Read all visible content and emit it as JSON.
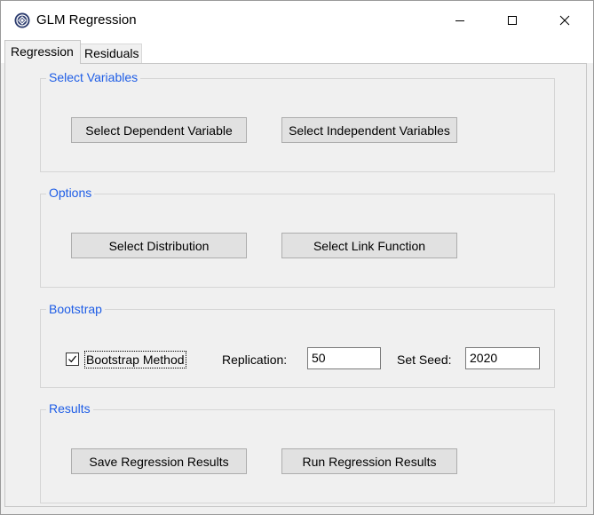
{
  "window": {
    "title": "GLM Regression",
    "minimize_glyph": "minimize-icon",
    "maximize_glyph": "maximize-icon",
    "close_glyph": "close-icon"
  },
  "tabs": [
    {
      "label": "Regression",
      "active": true
    },
    {
      "label": "Residuals",
      "active": false
    }
  ],
  "groups": {
    "select_variables": {
      "title": "Select Variables",
      "dependent_button": "Select Dependent Variable",
      "independent_button": "Select Independent Variables"
    },
    "options": {
      "title": "Options",
      "distribution_button": "Select Distribution",
      "link_button": "Select Link Function"
    },
    "bootstrap": {
      "title": "Bootstrap",
      "method_label": "Bootstrap Method",
      "method_checked": true,
      "replication_label": "Replication:",
      "replication_value": "50",
      "seed_label": "Set Seed:",
      "seed_value": "2020"
    },
    "results": {
      "title": "Results",
      "save_button": "Save Regression Results",
      "run_button": "Run Regression Results"
    }
  },
  "colors": {
    "group_title": "#1e5de6",
    "panel_bg": "#f0f0f0",
    "button_bg": "#e1e1e1"
  }
}
